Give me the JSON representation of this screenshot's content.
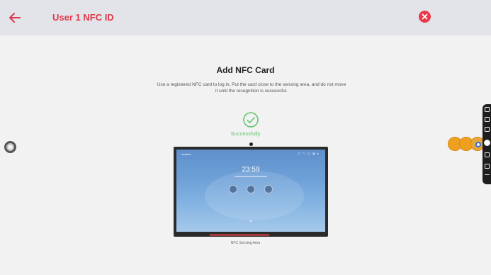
{
  "header": {
    "title": "User 1 NFC ID",
    "back_icon": "arrow-left-icon",
    "close_icon": "close-circle-icon",
    "accent_color": "#e0394a"
  },
  "main": {
    "heading": "Add NFC Card",
    "description": "Use a registered NFC card to log in, Put the card close to the sensing area, and do not move it until the recognition is successful.",
    "status_icon": "check-circle-icon",
    "status_text": "Successfully",
    "status_color": "#5cc46a",
    "caption": "NFC Sensing Area"
  },
  "illustration": {
    "brand": "newline",
    "clock": "23:59"
  },
  "sidebar": {
    "dock_icons": [
      "screen-icon",
      "whiteboard-icon",
      "window-icon",
      "home-icon",
      "back-icon",
      "apps-icon",
      "arrow-icon"
    ]
  }
}
